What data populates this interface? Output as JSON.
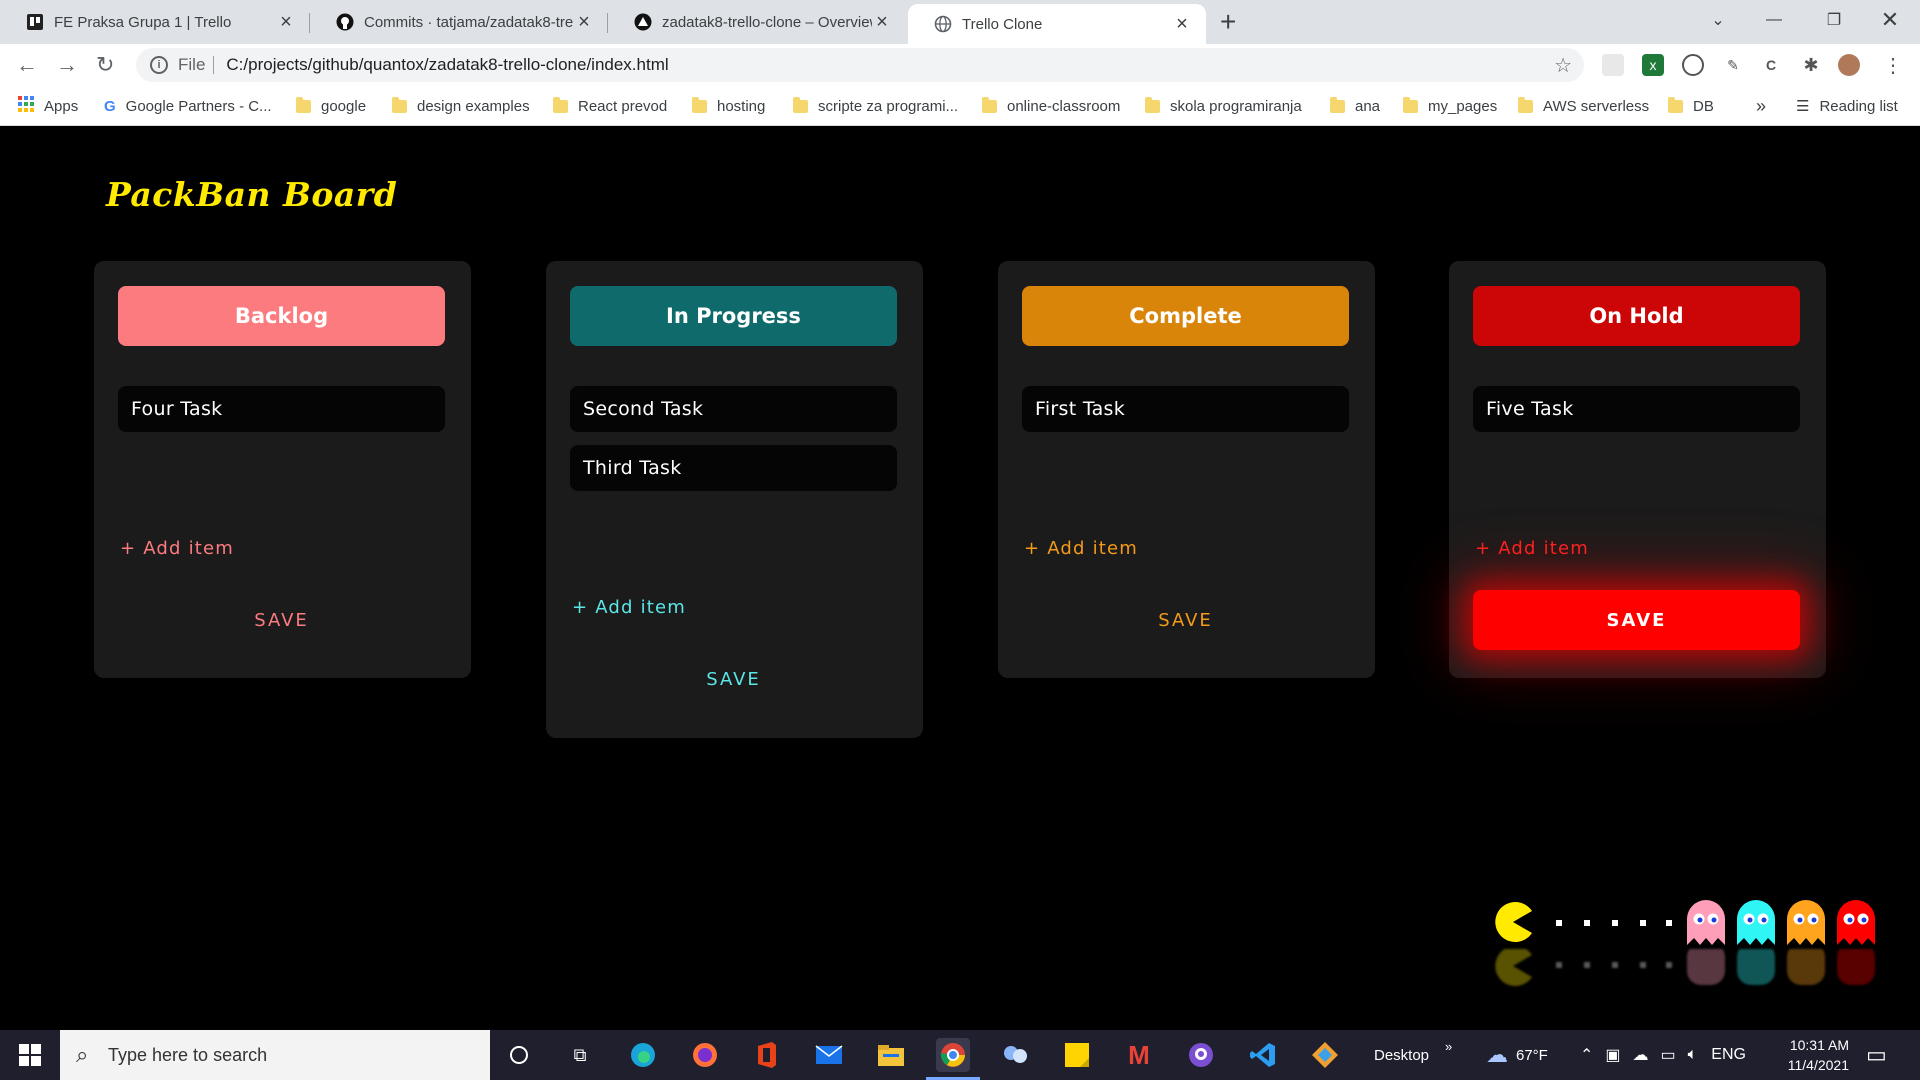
{
  "browser": {
    "tabs": [
      {
        "title": "FE Praksa Grupa 1 | Trello",
        "icon": "trello-icon"
      },
      {
        "title": "Commits · tatjama/zadatak8-trell",
        "icon": "github-icon"
      },
      {
        "title": "zadatak8-trello-clone – Overview",
        "icon": "vercel-icon"
      },
      {
        "title": "Trello Clone",
        "icon": "globe-icon",
        "active": true
      }
    ],
    "address": {
      "scheme": "File",
      "url": "C:/projects/github/quantox/zadatak8-trello-clone/index.html"
    },
    "bookmarks": [
      {
        "label": "Apps",
        "icon": "apps-grid-icon"
      },
      {
        "label": "Google Partners - C...",
        "icon": "google-icon"
      },
      {
        "label": "google",
        "icon": "folder-icon"
      },
      {
        "label": "design examples",
        "icon": "folder-icon"
      },
      {
        "label": "React prevod",
        "icon": "folder-icon"
      },
      {
        "label": "hosting",
        "icon": "folder-icon"
      },
      {
        "label": "scripte za programi...",
        "icon": "folder-icon"
      },
      {
        "label": "online-classroom",
        "icon": "folder-icon"
      },
      {
        "label": "skola programiranja",
        "icon": "folder-icon"
      },
      {
        "label": "ana",
        "icon": "folder-icon"
      },
      {
        "label": "my_pages",
        "icon": "folder-icon"
      },
      {
        "label": "AWS serverless",
        "icon": "folder-icon"
      },
      {
        "label": "DB",
        "icon": "folder-icon"
      }
    ],
    "overflow": "»",
    "reading_list": "Reading list"
  },
  "board": {
    "title": "PackBan Board",
    "columns": [
      {
        "name": "Backlog",
        "color": "#fc7b7f",
        "accent": "#fc7b7f",
        "tasks": [
          "Four Task"
        ],
        "add_label": "+ Add item",
        "save_label": "SAVE"
      },
      {
        "name": "In Progress",
        "color": "#0f6b6b",
        "accent": "#5ce6e6",
        "tasks": [
          "Second Task",
          "Third Task"
        ],
        "add_label": "+ Add item",
        "save_label": "SAVE"
      },
      {
        "name": "Complete",
        "color": "#d9850a",
        "accent": "#f59a1a",
        "tasks": [
          "First Task"
        ],
        "add_label": "+ Add item",
        "save_label": "SAVE"
      },
      {
        "name": "On Hold",
        "color": "#cc0606",
        "accent": "#ff2222",
        "tasks": [
          "Five Task"
        ],
        "add_label": "+ Add item",
        "save_label": "SAVE",
        "save_highlighted": true
      }
    ]
  },
  "taskbar": {
    "search_placeholder": "Type here to search",
    "desktop_label": "Desktop",
    "weather": "67°F",
    "language": "ENG",
    "time": "10:31 AM",
    "date": "11/4/2021"
  }
}
